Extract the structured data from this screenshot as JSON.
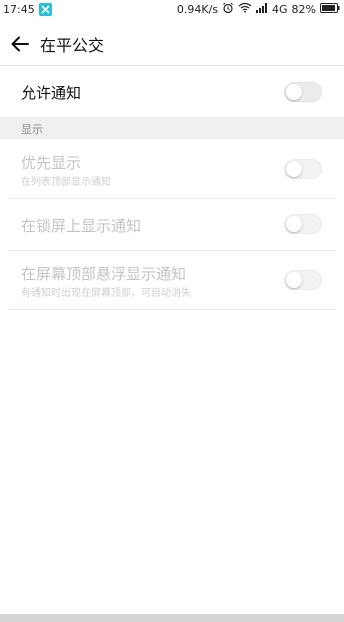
{
  "status_bar": {
    "time": "17:45",
    "net_speed": "0.94K/s",
    "network": "4G",
    "battery": "82%"
  },
  "header": {
    "title": "在平公交"
  },
  "allow_notify": {
    "label": "允许通知",
    "on": false
  },
  "section": {
    "label": "显示"
  },
  "settings": [
    {
      "title": "优先显示",
      "subtitle": "在列表顶部显示通知",
      "on": false
    },
    {
      "title": "在锁屏上显示通知",
      "subtitle": "",
      "on": false
    },
    {
      "title": "在屏幕顶部悬浮显示通知",
      "subtitle": "有通知时出现在屏幕顶部，可自动消失",
      "on": false
    }
  ]
}
